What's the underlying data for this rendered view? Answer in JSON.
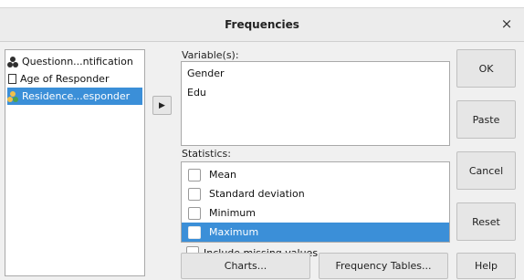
{
  "window": {
    "title": "Frequencies",
    "close_glyph": "×"
  },
  "source_list": {
    "items": [
      {
        "label": "Questionn...ntification",
        "icon": "nominal-icon",
        "selected": false
      },
      {
        "label": "Age of Responder",
        "icon": "scale-icon",
        "selected": false
      },
      {
        "label": "Residence...esponder",
        "icon": "nominal-icon",
        "selected": true
      }
    ]
  },
  "move_button": {
    "glyph": "▶"
  },
  "variables": {
    "label": "Variable(s):",
    "items": [
      "Gender",
      "Edu"
    ]
  },
  "statistics": {
    "label": "Statistics:",
    "items": [
      {
        "label": "Mean",
        "checked": false,
        "selected": false
      },
      {
        "label": "Standard deviation",
        "checked": false,
        "selected": false
      },
      {
        "label": "Minimum",
        "checked": false,
        "selected": false
      },
      {
        "label": "Maximum",
        "checked": false,
        "selected": true
      }
    ]
  },
  "include_missing": {
    "label": "Include missing values",
    "checked": false
  },
  "buttons": {
    "ok": "OK",
    "paste": "Paste",
    "cancel": "Cancel",
    "reset": "Reset",
    "help": "Help",
    "charts": "Charts...",
    "frequency_tables": "Frequency Tables..."
  },
  "colors": {
    "selection": "#3b8fd8",
    "dialog_bg": "#f0f0f0"
  }
}
